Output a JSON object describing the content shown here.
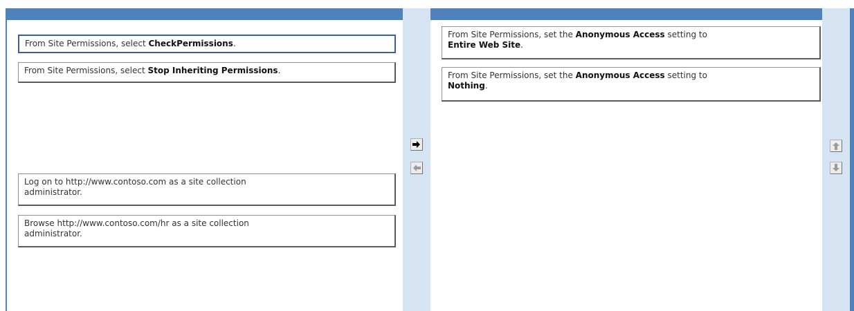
{
  "left_list": {
    "items": [
      {
        "prefix": "From Site Permissions, select ",
        "bold": "CheckPermissions",
        "suffix": "."
      },
      {
        "prefix": "From Site Permissions, select ",
        "bold": "Stop Inheriting Permissions",
        "suffix": "."
      },
      {
        "text": "Log on to http://www.contoso.com as a site collection administrator."
      },
      {
        "text": "Browse http://www.contoso.com/hr as a site collection administrator."
      }
    ]
  },
  "right_list": {
    "items": [
      {
        "prefix": "From Site Permissions, set the ",
        "bold": "Anonymous Access",
        "middle": " setting to ",
        "bold2": "Entire Web Site",
        "suffix": "."
      },
      {
        "prefix": "From Site Permissions, set the ",
        "bold": "Anonymous Access",
        "middle": " setting to ",
        "bold2": "Nothing",
        "suffix": "."
      }
    ]
  },
  "buttons": {
    "move_right": "arrow-right-icon",
    "move_left": "arrow-left-icon",
    "move_up": "arrow-up-icon",
    "move_down": "arrow-down-icon"
  },
  "colors": {
    "header": "#4f81bd",
    "gutter": "#d5e3f3",
    "selected_border": "#3a5f9c"
  }
}
